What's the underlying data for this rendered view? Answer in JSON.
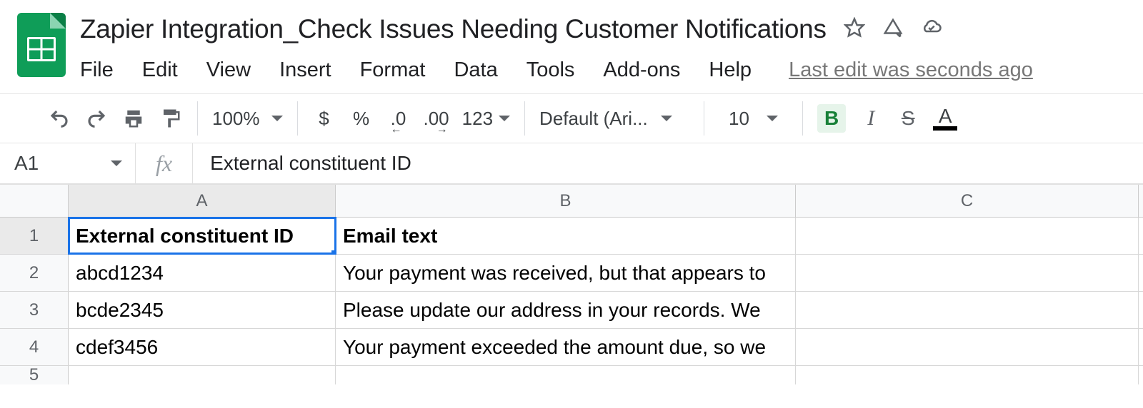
{
  "doc": {
    "title": "Zapier Integration_Check Issues Needing Customer Notifications"
  },
  "menu": {
    "file": "File",
    "edit": "Edit",
    "view": "View",
    "insert": "Insert",
    "format": "Format",
    "data": "Data",
    "tools": "Tools",
    "addons": "Add-ons",
    "help": "Help",
    "last_edit": "Last edit was seconds ago"
  },
  "toolbar": {
    "zoom": "100%",
    "currency": "$",
    "percent": "%",
    "dec_dec": ".0",
    "inc_dec": ".00",
    "more_formats": "123",
    "font": "Default (Ari...",
    "font_size": "10",
    "bold": "B",
    "italic": "I",
    "strike": "S",
    "text_color": "A"
  },
  "namebox": {
    "cell": "A1",
    "fx": "fx",
    "formula": "External constituent ID"
  },
  "columns": {
    "A": "A",
    "B": "B",
    "C": "C"
  },
  "rows": {
    "r1": "1",
    "r2": "2",
    "r3": "3",
    "r4": "4",
    "r5": "5"
  },
  "data": {
    "headers": {
      "A": "External constituent ID",
      "B": "Email text"
    },
    "r2": {
      "A": "abcd1234",
      "B": "Your payment was received, but that appears to"
    },
    "r3": {
      "A": "bcde2345",
      "B": "Please update our address in your records. We"
    },
    "r4": {
      "A": "cdef3456",
      "B": "Your payment exceeded the amount due, so we"
    }
  }
}
